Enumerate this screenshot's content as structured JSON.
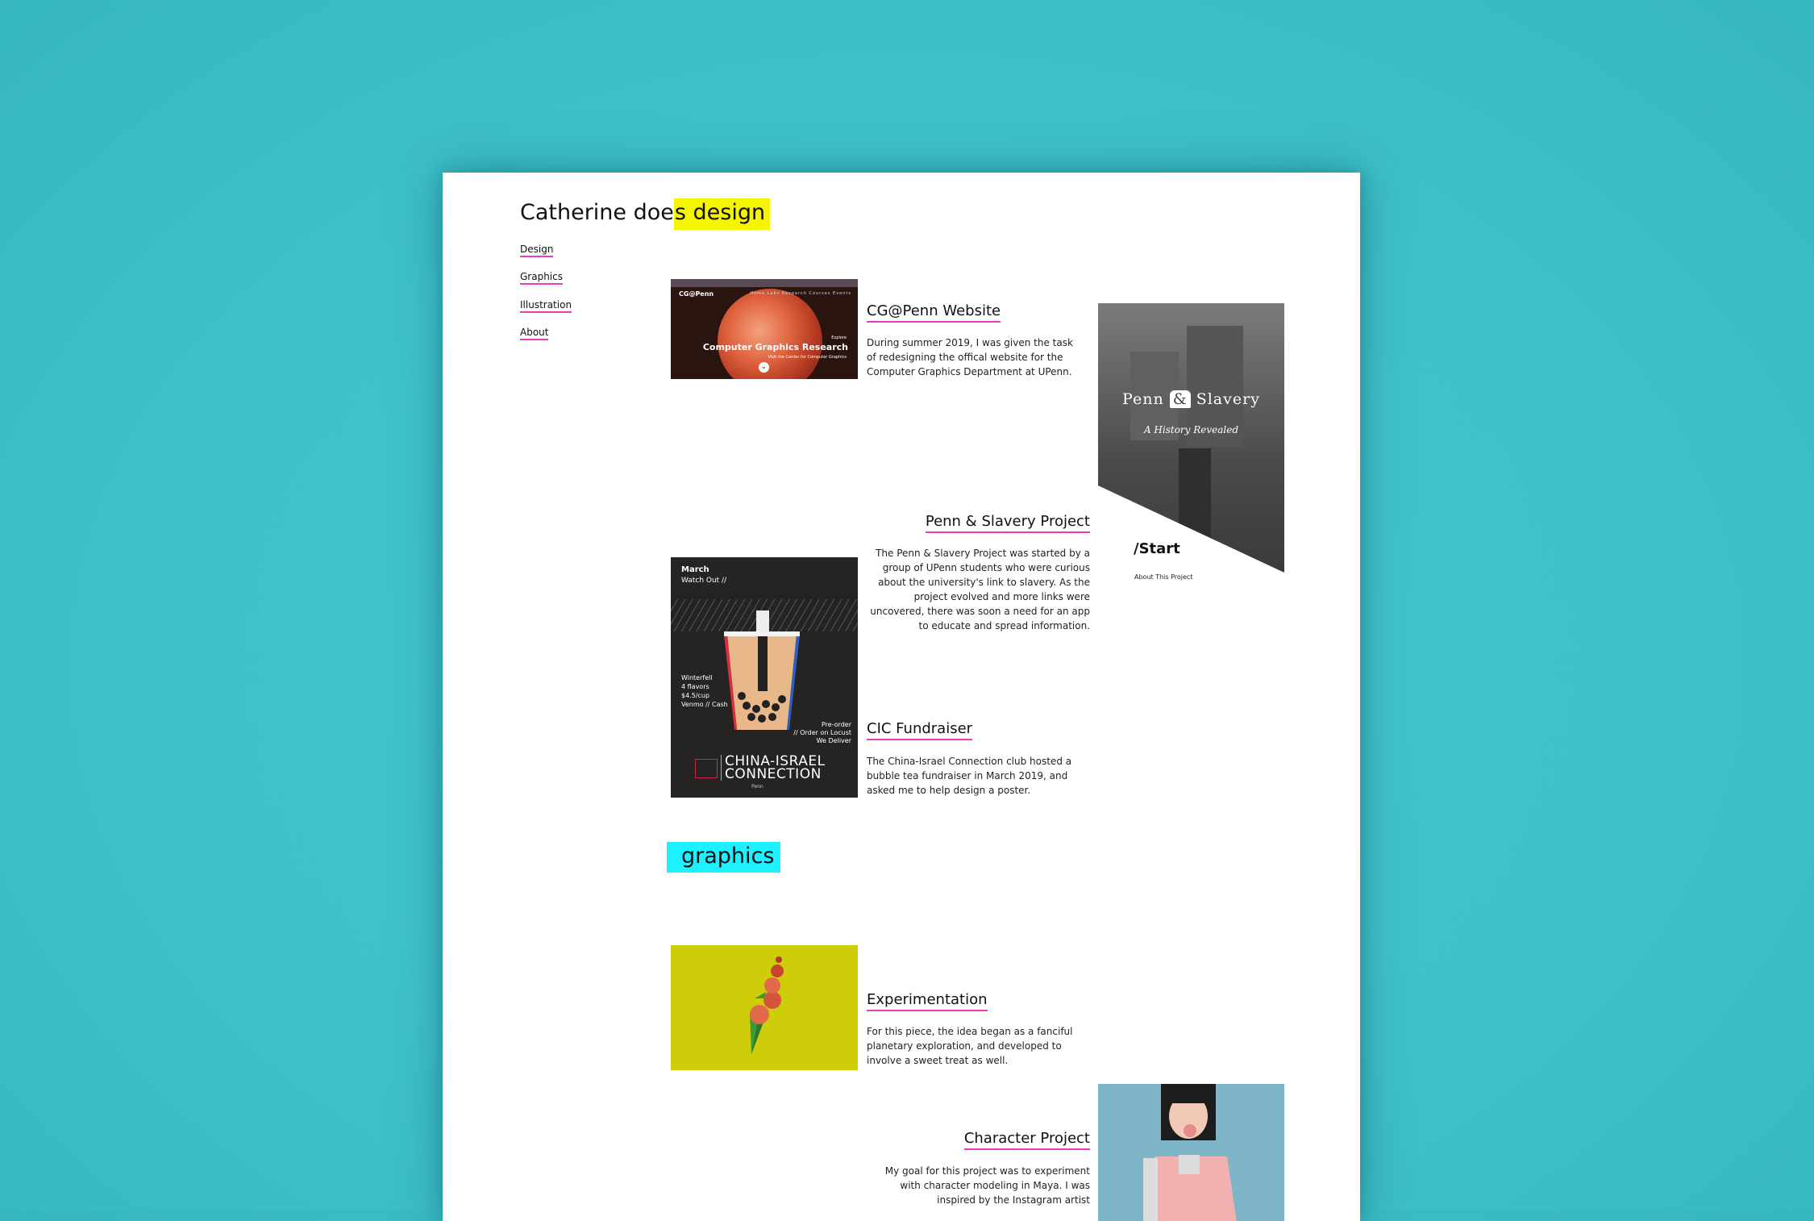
{
  "brand": {
    "prefix": "Catherine doe",
    "highlight": "s design"
  },
  "nav": [
    "Design",
    "Graphics",
    "Illustration",
    "About"
  ],
  "colors": {
    "background": "#40c3cc",
    "underline": "#e83fb8",
    "brand_highlight": "#f5f500",
    "section_highlight": "#1ff0ff"
  },
  "projects": [
    {
      "title": "CG@Penn Website",
      "desc": "During summer 2019, I was given the task of redesigning the offical website for the Computer Graphics Department at UPenn.",
      "thumb": {
        "logo": "CG@Penn",
        "nav": "Home  Labs  Research  Courses  Events",
        "explore": "Explore",
        "heading": "Computer Graphics Research",
        "sub": "Visit the Center for Computer Graphics"
      }
    },
    {
      "title": "Penn & Slavery Project",
      "desc": "The Penn & Slavery Project was started by a group of UPenn students who were curious about the university's link to slavery. As the project evolved and more links were uncovered, there was soon a need for an app to educate and spread information.",
      "thumb": {
        "title_a": "Penn",
        "amp": "&",
        "title_b": "Slavery",
        "tagline": "A History Revealed",
        "start": "Start",
        "about": "About This Project"
      }
    },
    {
      "title": "CIC Fundraiser",
      "desc": "The China-Israel Connection club hosted a bubble tea fundraiser in March 2019, and asked me to help design a poster.",
      "thumb": {
        "month": "March",
        "watch": "Watch Out //",
        "info": [
          "Winterfell",
          "4 flavors",
          "$4.5/cup",
          "Venmo // Cash"
        ],
        "preorder": [
          "Pre-order",
          "// Order on Locust",
          "We Deliver"
        ],
        "logo": [
          "CHINA-ISRAEL",
          "CONNECTION"
        ],
        "penn": "Penn"
      }
    }
  ],
  "section": "graphics",
  "graphics": [
    {
      "title": "Experimentation",
      "desc": "For this piece, the idea began as a fanciful planetary exploration, and developed to involve a sweet treat as well."
    },
    {
      "title": "Character Project",
      "desc": "My goal for this project was to experiment with character modeling in Maya. I was inspired by the Instagram artist"
    }
  ]
}
